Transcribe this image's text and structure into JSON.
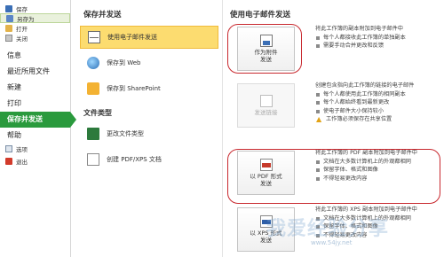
{
  "nav": {
    "save": "保存",
    "saveas": "另存为",
    "open": "打开",
    "close": "关闭",
    "info": "信息",
    "recent": "最近所用文件",
    "new": "新建",
    "print": "打印",
    "saveandsend": "保存并发送",
    "help": "帮助",
    "options": "选项",
    "exit": "退出"
  },
  "middle": {
    "title": "保存并发送",
    "items": [
      "使用电子邮件发送",
      "保存到 Web",
      "保存到 SharePoint"
    ],
    "filetype_title": "文件类型",
    "filetype_items": [
      "更改文件类型",
      "创建 PDF/XPS 文档"
    ]
  },
  "right": {
    "title": "使用电子邮件发送",
    "options": [
      {
        "button": [
          "作为附件",
          "发送"
        ],
        "desc": "将此工作簿的副本附加到电子邮件中",
        "bullets": [
          "每个人都接收此工作簿的单独副本",
          "需要手动合并更改和反馈"
        ],
        "warning": "",
        "disabled": false
      },
      {
        "button": [
          "发送链接"
        ],
        "desc": "创建包含指向此工作簿的链接的电子邮件",
        "bullets": [
          "每个人都使用此工作簿的相同副本",
          "每个人都始终看到最新更改",
          "使电子邮件大小保持较小"
        ],
        "warning": "工作簿必须保存在共享位置",
        "disabled": true
      },
      {
        "button": [
          "以 PDF 形式",
          "发送"
        ],
        "desc": "将此工作簿的 PDF 副本附加到电子邮件中",
        "bullets": [
          "文档在大多数计算机上的外观都相同",
          "保留字体、格式和图像",
          "不得轻易更改内容"
        ],
        "warning": "",
        "disabled": false
      },
      {
        "button": [
          "以 XPS 形式",
          "发送"
        ],
        "desc": "将此工作簿的 XPS 副本附加到电子邮件中",
        "bullets": [
          "文档在大多数计算机上的外观都相同",
          "保留字体、格式和图像",
          "不得轻易更改内容"
        ],
        "warning": "",
        "disabled": false
      }
    ]
  },
  "watermark": "我爱经验分享",
  "watermark_domain": "www.54jy.net",
  "colors": {
    "active_nav": "#2a9a3d",
    "selected_item": "#fcdc70",
    "highlight_ring": "#c8282e"
  }
}
